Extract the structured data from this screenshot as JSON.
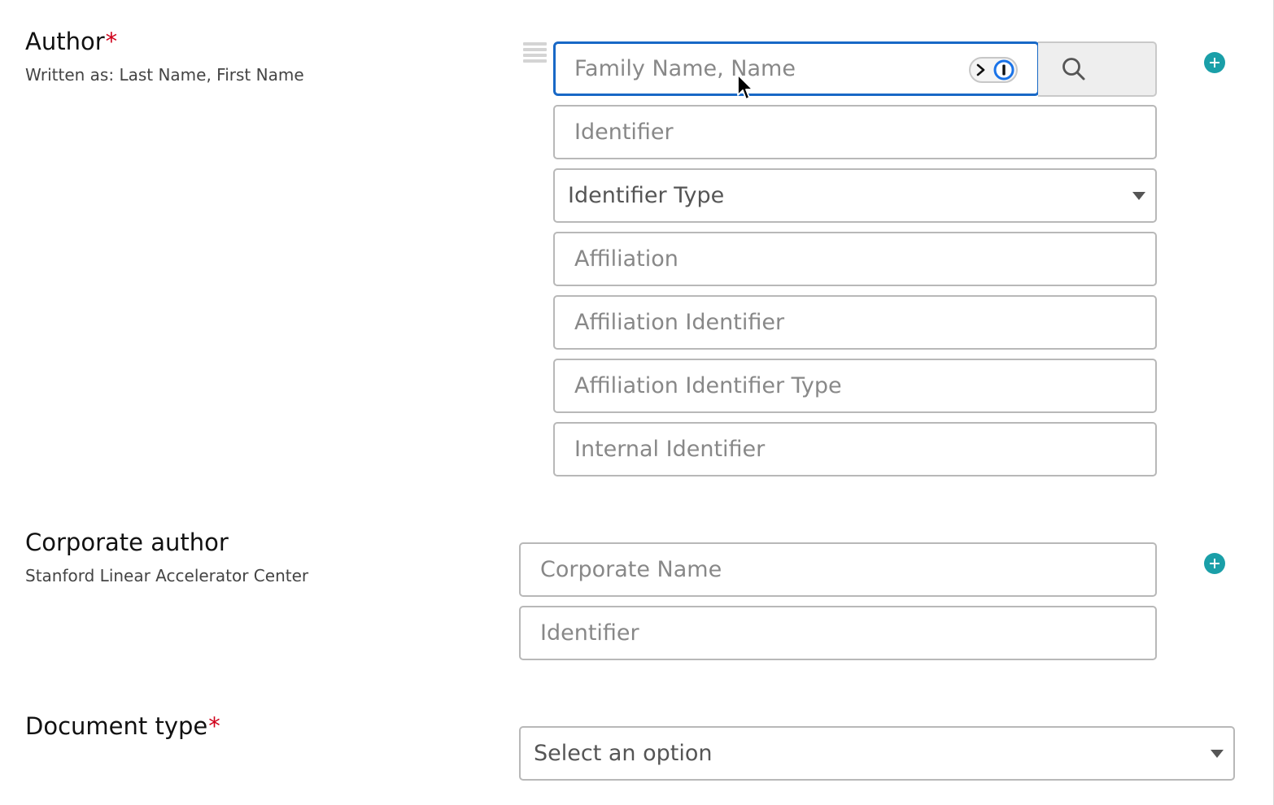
{
  "author": {
    "label": "Author",
    "required_mark": "*",
    "hint": "Written as: Last Name, First Name",
    "name_placeholder": "Family Name, Name",
    "identifier_placeholder": "Identifier",
    "identifier_type_value": "Identifier Type",
    "affiliation_placeholder": "Affiliation",
    "affiliation_identifier_placeholder": "Affiliation Identifier",
    "affiliation_identifier_type_placeholder": "Affiliation Identifier Type",
    "internal_identifier_placeholder": "Internal Identifier"
  },
  "corporate_author": {
    "label": "Corporate author",
    "hint": "Stanford Linear Accelerator Center",
    "name_placeholder": "Corporate Name",
    "identifier_placeholder": "Identifier"
  },
  "document_type": {
    "label": "Document type",
    "required_mark": "*",
    "select_value": "Select an option"
  },
  "icons": {
    "drag": "drag-handle-icon",
    "password_manager": "password-manager-icon",
    "search": "search-icon",
    "add": "plus-circle-icon",
    "dropdown": "caret-down-icon"
  },
  "colors": {
    "focus_border": "#1868c6",
    "required": "#d0021b",
    "add_button": "#1a9fa8"
  }
}
